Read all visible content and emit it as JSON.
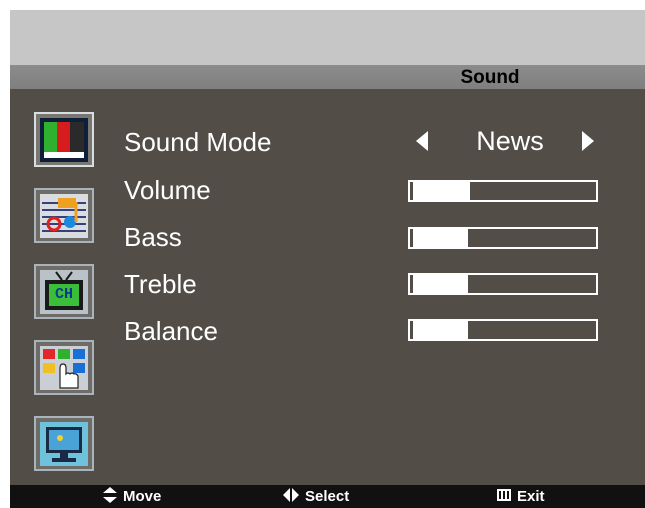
{
  "menu": {
    "title": "Sound"
  },
  "sidebar": {
    "items": [
      {
        "icon": "picture-icon",
        "active": true
      },
      {
        "icon": "sound-icon",
        "active": false
      },
      {
        "icon": "channel-icon",
        "label": "CH",
        "active": false
      },
      {
        "icon": "function-icon",
        "active": false
      },
      {
        "icon": "pc-screen-icon",
        "active": false
      }
    ]
  },
  "settings": {
    "sound_mode": {
      "label": "Sound Mode",
      "value": "News"
    },
    "volume": {
      "label": "Volume",
      "level": 0.32
    },
    "bass": {
      "label": "Bass",
      "level": 0.31
    },
    "treble": {
      "label": "Treble",
      "level": 0.31
    },
    "balance": {
      "label": "Balance",
      "level": 0.31
    }
  },
  "footer": {
    "move": "Move",
    "select": "Select",
    "exit": "Exit"
  },
  "colors": {
    "panel": "#524d47",
    "title_bar": "#8c8c8c",
    "footer": "#111111"
  }
}
